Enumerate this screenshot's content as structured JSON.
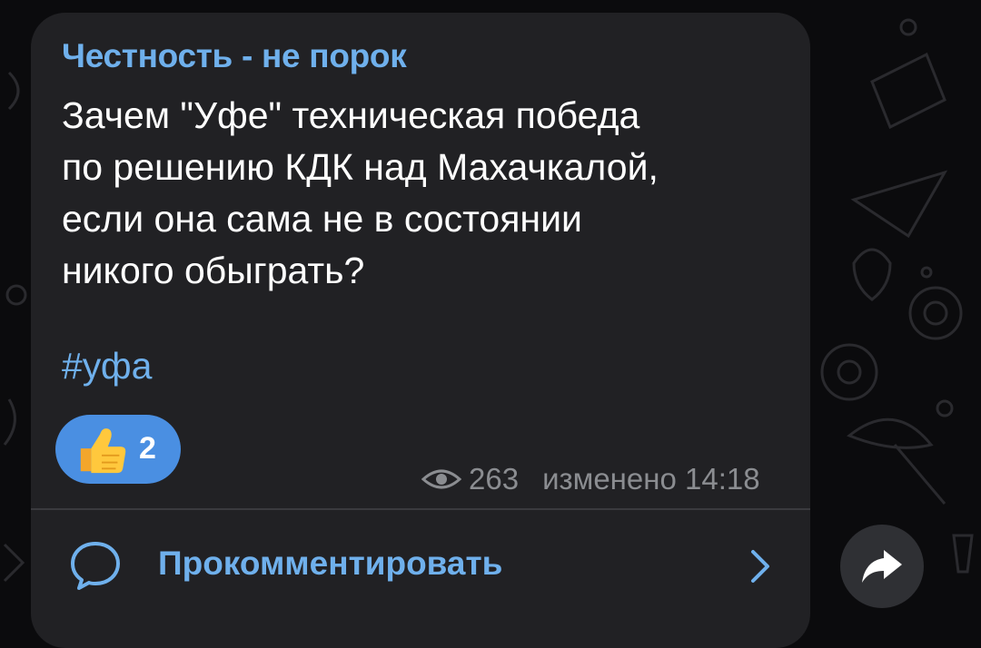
{
  "post": {
    "channel_name": "Честность - не порок",
    "text_lines": [
      "Зачем \"Уфе\" техническая победа",
      "по решению КДК над Махачкалой,",
      "если она сама не в состоянии",
      "никого обыграть?"
    ],
    "hashtag": "#уфа",
    "reaction": {
      "icon": "thumbs-up-icon",
      "count": "2"
    },
    "views": "263",
    "status": "изменено 14:18"
  },
  "comments": {
    "label": "Прокомментировать"
  },
  "colors": {
    "background": "#0b0b0d",
    "bubble": "#212124",
    "accent": "#6fb0ec",
    "reaction_bg": "#4a8fe2",
    "text": "#ffffff",
    "meta": "#8b8d91"
  }
}
